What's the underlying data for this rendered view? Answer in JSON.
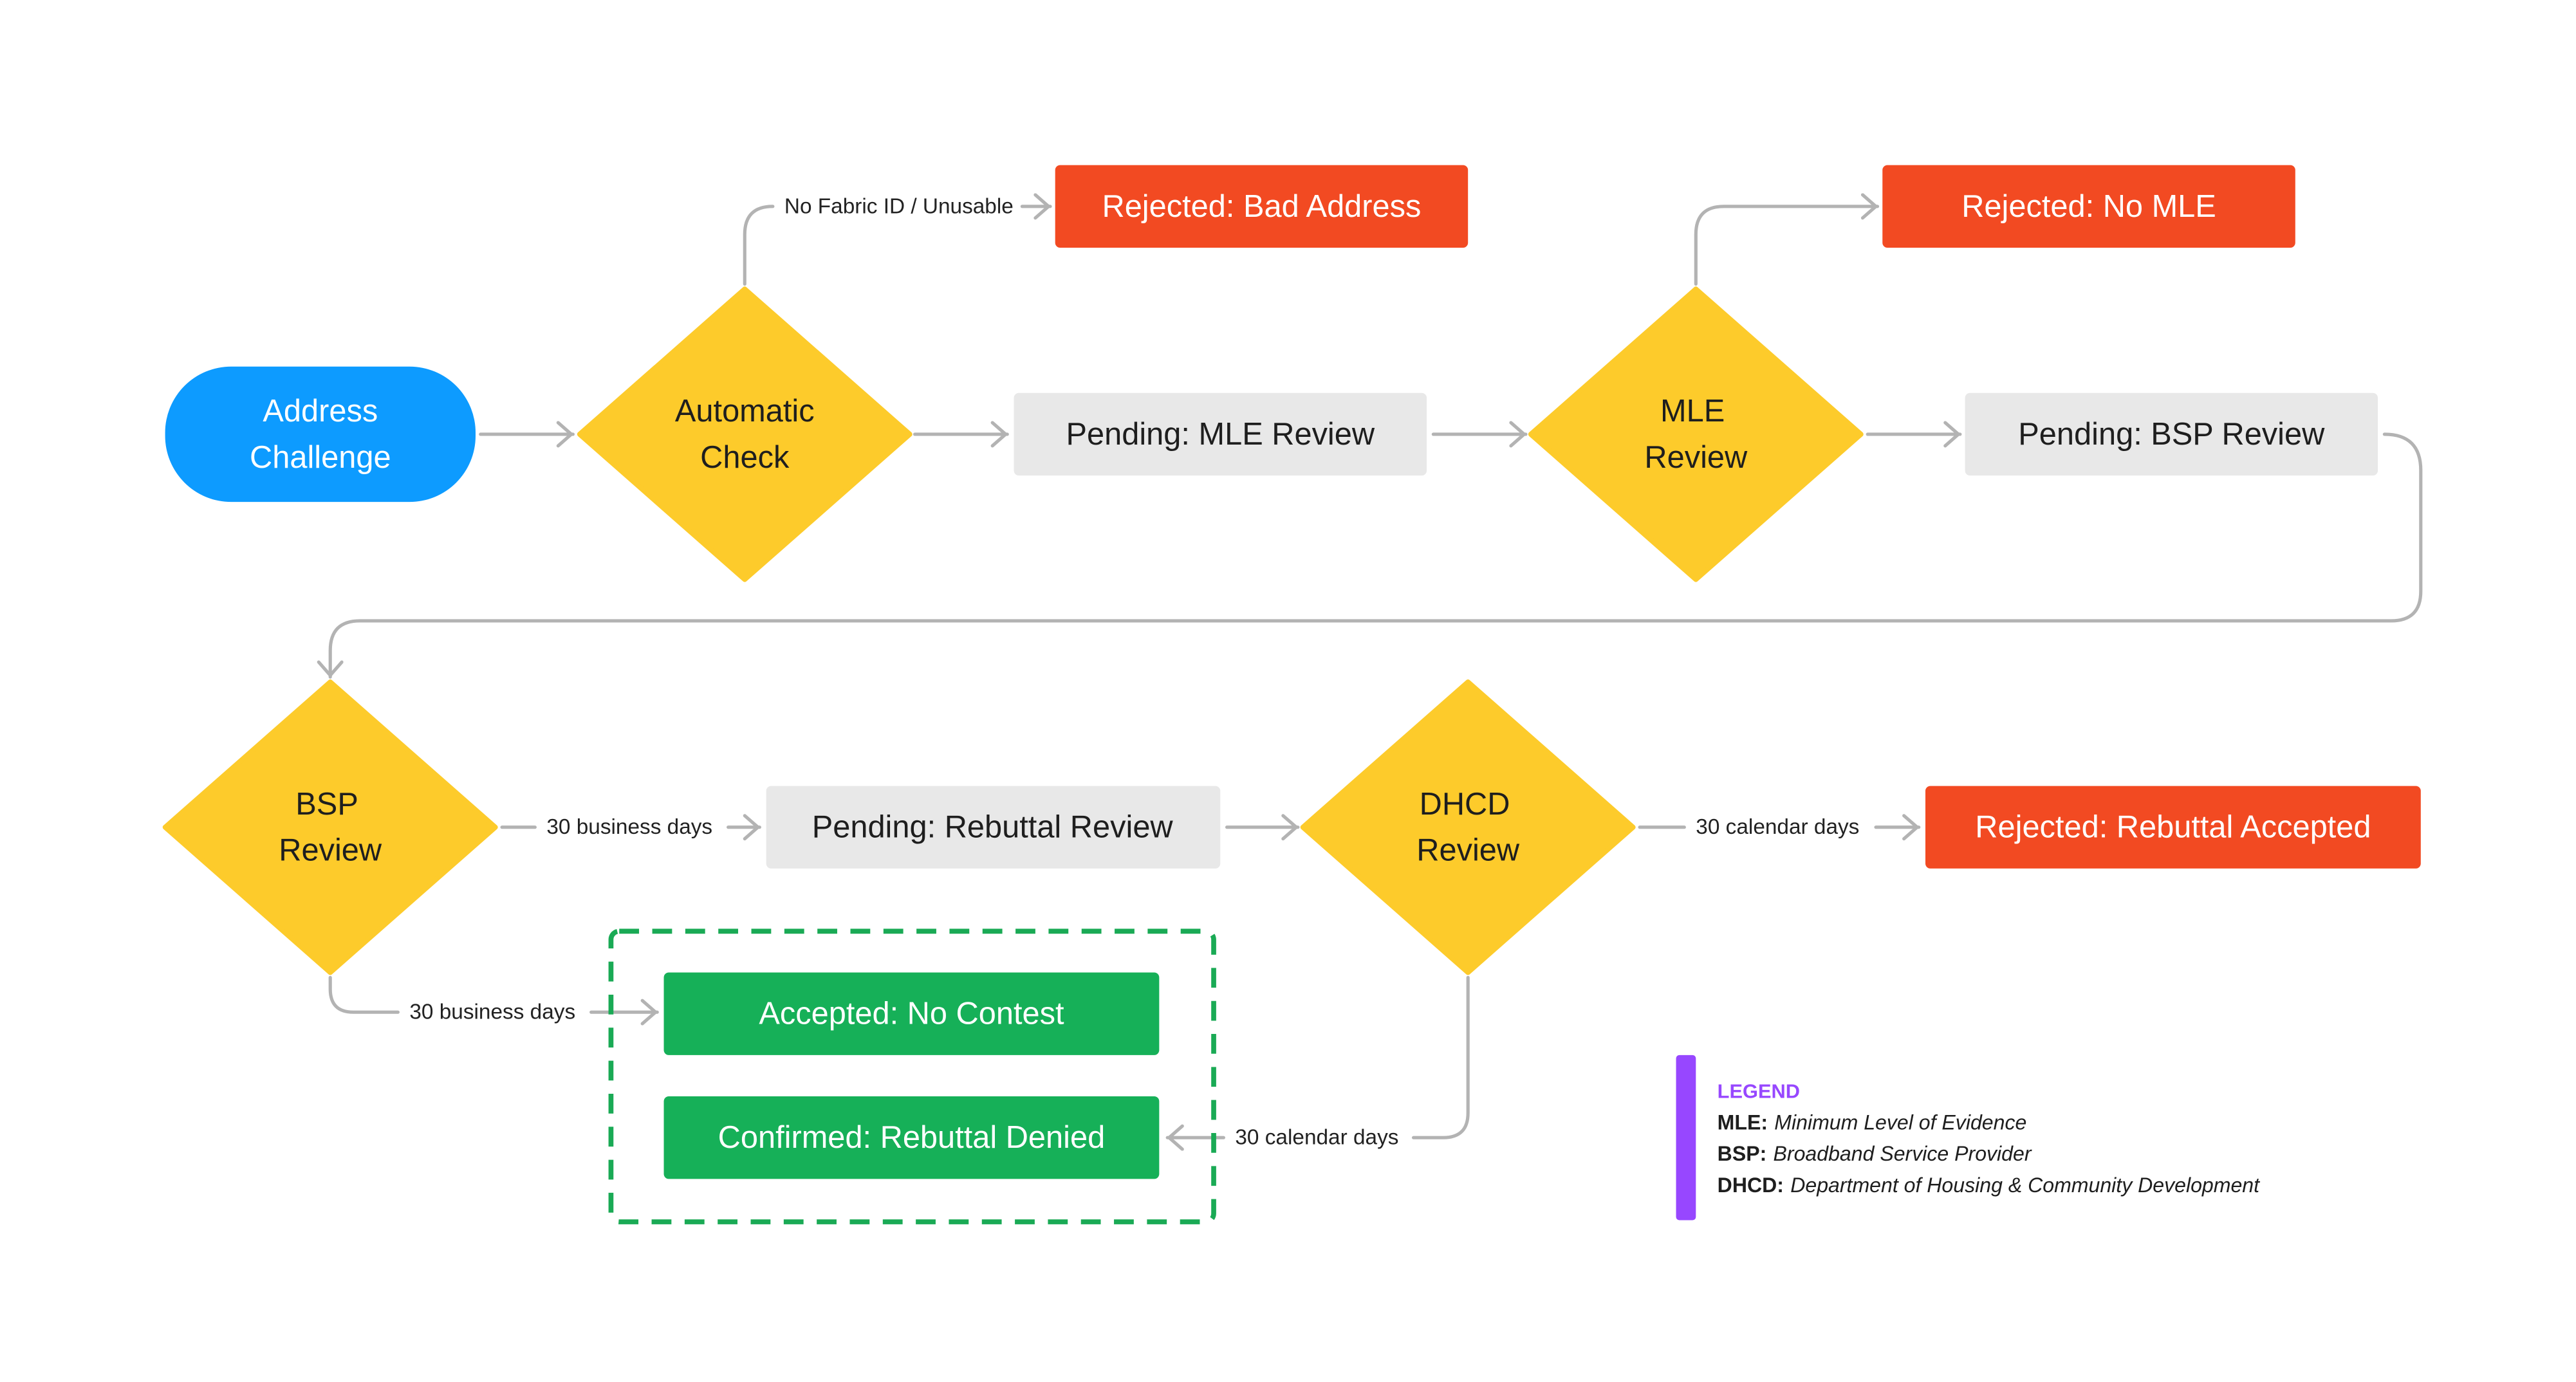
{
  "colors": {
    "start": "#0d9bff",
    "decision": "#fdcb2b",
    "pending": "#e8e8e8",
    "rejected": "#f24a22",
    "accepted": "#16b058",
    "group_border": "#1aaa55",
    "connector": "#b3b3b3",
    "legend_accent": "#9747ff"
  },
  "nodes": {
    "address_challenge": [
      "Address",
      "Challenge"
    ],
    "automatic_check": [
      "Automatic",
      "Check"
    ],
    "pending_mle": "Pending: MLE Review",
    "mle_review": [
      "MLE",
      "Review"
    ],
    "pending_bsp": "Pending: BSP Review",
    "rejected_bad_address": "Rejected: Bad Address",
    "rejected_no_mle": "Rejected: No MLE",
    "bsp_review": [
      "BSP",
      "Review"
    ],
    "pending_rebuttal": "Pending: Rebuttal Review",
    "dhcd_review": [
      "DHCD",
      "Review"
    ],
    "rejected_rebuttal_accepted": "Rejected: Rebuttal Accepted",
    "accepted_no_contest": "Accepted: No Contest",
    "confirmed_rebuttal_denied": "Confirmed: Rebuttal Denied"
  },
  "edges": {
    "no_fabric_id": "No Fabric ID / Unusable",
    "bsp_to_rebuttal": "30 business days",
    "bsp_to_accepted": "30 business days",
    "dhcd_to_rejected": "30 calendar days",
    "dhcd_to_confirmed": "30 calendar days"
  },
  "legend": {
    "title": "LEGEND",
    "items": [
      {
        "term": "MLE:",
        "definition": "Minimum Level of Evidence"
      },
      {
        "term": "BSP:",
        "definition": "Broadband Service Provider"
      },
      {
        "term": "DHCD:",
        "definition": "Department of Housing & Community Development"
      }
    ]
  }
}
